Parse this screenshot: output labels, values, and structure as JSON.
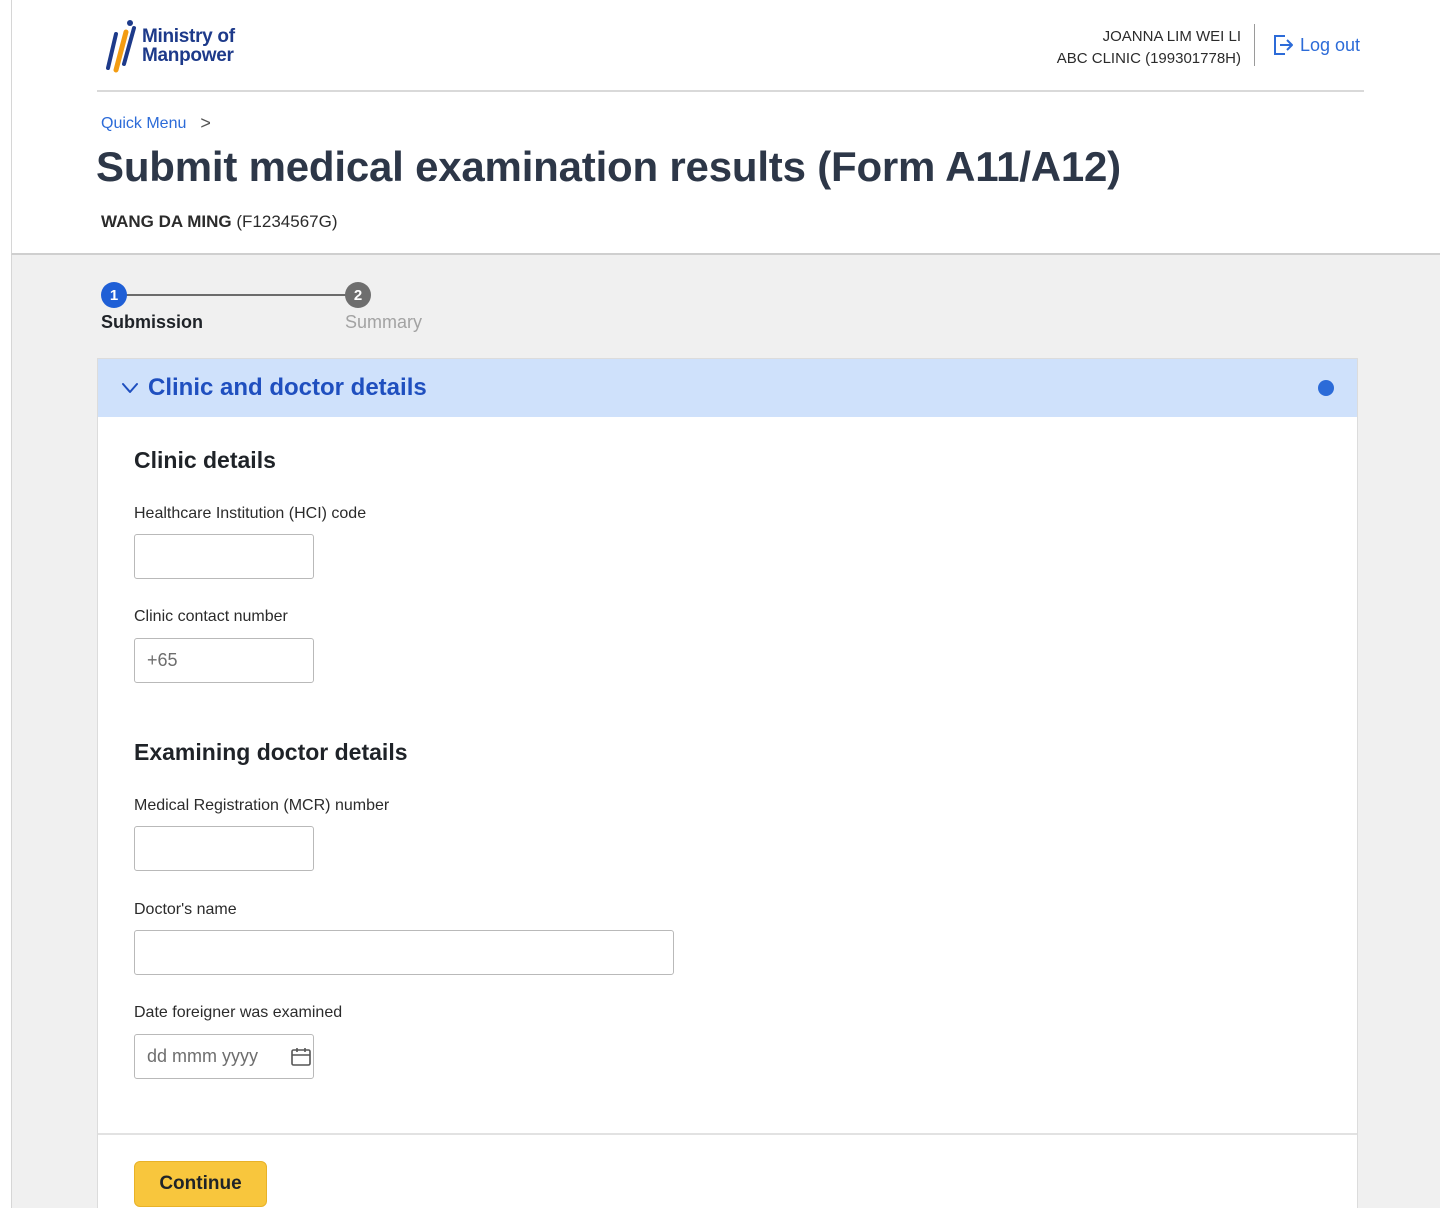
{
  "header": {
    "logo_line1": "Ministry of",
    "logo_line2": "Manpower",
    "user_name": "JOANNA LIM WEI LI",
    "user_org": "ABC CLINIC (199301778H)",
    "logout_label": "Log out"
  },
  "breadcrumb": {
    "item": "Quick Menu",
    "separator": ">"
  },
  "page": {
    "title": "Submit medical examination results (Form A11/A12)",
    "applicant_name": "WANG DA MING",
    "applicant_id": "(F1234567G)"
  },
  "stepper": {
    "steps": [
      {
        "number": "1",
        "label": "Submission",
        "state": "active"
      },
      {
        "number": "2",
        "label": "Summary",
        "state": "inactive"
      }
    ]
  },
  "accordion": {
    "title": "Clinic and doctor details",
    "expanded": true
  },
  "clinic": {
    "section_title": "Clinic details",
    "hci_label": "Healthcare Institution (HCI) code",
    "hci_value": "",
    "contact_label": "Clinic contact number",
    "contact_placeholder": "+65"
  },
  "doctor": {
    "section_title": "Examining doctor details",
    "mcr_label": "Medical Registration (MCR) number",
    "mcr_value": "",
    "name_label": "Doctor's name",
    "name_value": "",
    "date_label": "Date foreigner was examined",
    "date_placeholder": "dd mmm yyyy"
  },
  "actions": {
    "continue_label": "Continue"
  },
  "colors": {
    "accent_blue": "#2c6bd8",
    "title_blue": "#1f4fbf",
    "accordion_bg": "#cfe1fb",
    "button_yellow": "#f8c63d"
  },
  "icons": {
    "logo": "mom-logo-icon",
    "logout": "logout-icon",
    "chevron": "chevron-down-icon",
    "calendar": "calendar-icon"
  }
}
